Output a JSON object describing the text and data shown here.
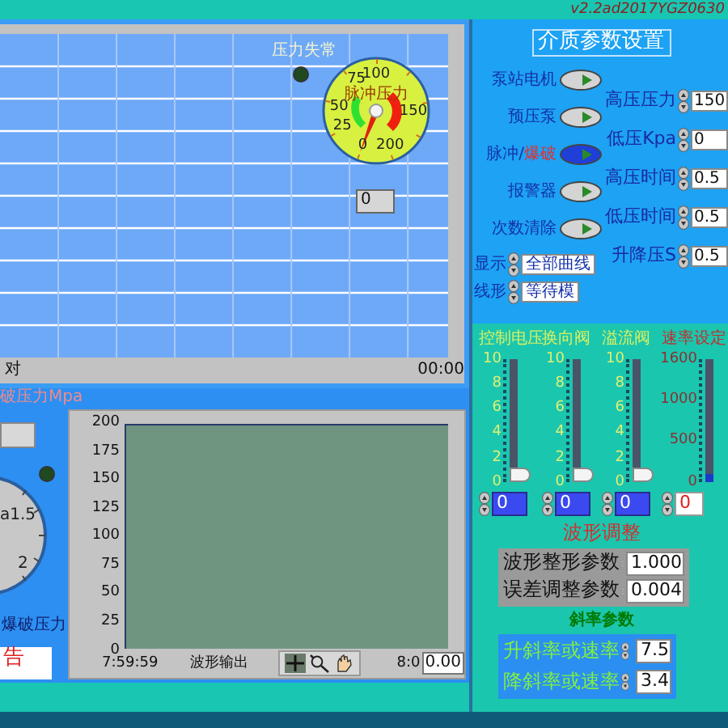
{
  "version": "v2.2ad2017YGZ0630",
  "top_chart": {
    "x_start": "对",
    "x_end": "00:00",
    "alarm": {
      "label": "压力失常",
      "on": false
    },
    "gauge": {
      "label": "脉冲压力",
      "ticks": [
        "0",
        "25",
        "50",
        "75",
        "100",
        "150",
        "200"
      ],
      "reading": "0"
    }
  },
  "burst": {
    "title": "破压力Mpa",
    "ticks": [
      "a1.5",
      "2"
    ],
    "label": "爆破压力",
    "led_on": false,
    "alarm_text": "告"
  },
  "wave_chart": {
    "yticks": [
      "200",
      "175",
      "150",
      "125",
      "100",
      "75",
      "50",
      "25",
      "0"
    ],
    "x_start": "7:59:59",
    "title": "波形输出",
    "x_end": "8:0",
    "value": "0.00"
  },
  "settings": {
    "title": "介质参数设置",
    "toggles": [
      {
        "label": "泵站电机",
        "on": false
      },
      {
        "label": "预压泵",
        "on": false
      },
      {
        "label": "脉冲/",
        "label_alert": "爆破",
        "on": true
      },
      {
        "label": "报警器",
        "on": false
      },
      {
        "label": "次数清除",
        "on": false
      }
    ],
    "rings": [
      {
        "label": "显示",
        "value": "全部曲线"
      },
      {
        "label": "线形",
        "value": "等待模"
      }
    ],
    "numerics": [
      {
        "label": "高压压力",
        "value": "150"
      },
      {
        "label": "低压Kpa",
        "value": "0"
      },
      {
        "label": "高压时间",
        "value": "0.5"
      },
      {
        "label": "低压时间",
        "value": "0.5"
      },
      {
        "label": "升降压S",
        "value": "0.5"
      }
    ]
  },
  "sliders": [
    {
      "kind": "valve",
      "label": "控制电压",
      "ticks": [
        "10",
        "8",
        "6",
        "4",
        "2",
        "0"
      ],
      "level": 0,
      "value": "0"
    },
    {
      "kind": "valve",
      "label": "换向阀",
      "ticks": [
        "10",
        "8",
        "6",
        "4",
        "2",
        "0"
      ],
      "level": 0,
      "value": "0"
    },
    {
      "kind": "valve",
      "label": "溢流阀",
      "ticks": [
        "10",
        "8",
        "6",
        "4",
        "2",
        "0"
      ],
      "level": 0,
      "value": "0"
    },
    {
      "kind": "rate",
      "label": "速率设定",
      "ticks": [
        "1600",
        "1000",
        "500",
        "0"
      ],
      "level": 0,
      "value": "0"
    }
  ],
  "wave_adjust": {
    "title": "波形调整",
    "params": [
      {
        "label": "波形整形参数",
        "value": "1.000"
      },
      {
        "label": "误差调整参数",
        "value": "0.004"
      }
    ]
  },
  "slope": {
    "title": "斜率参数",
    "params": [
      {
        "label": "升斜率或速率",
        "value": "7.5"
      },
      {
        "label": "降斜率或速率",
        "value": "3.4"
      }
    ]
  }
}
